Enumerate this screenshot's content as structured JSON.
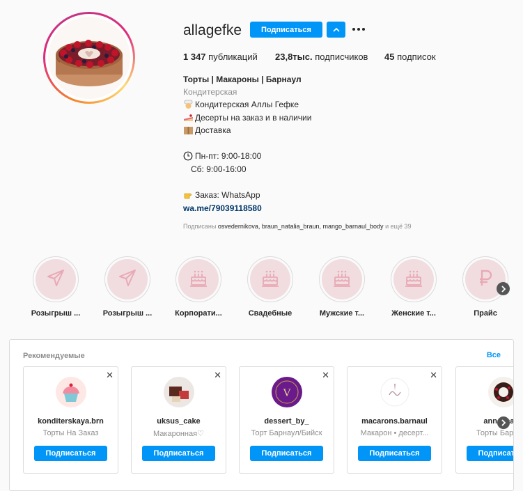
{
  "profile": {
    "username": "allagefke",
    "follow_label": "Подписаться",
    "stats": {
      "posts_num": "1 347",
      "posts_label": " публикаций",
      "followers_num": "23,8тыс.",
      "followers_label": " подписчиков",
      "following_num": "45",
      "following_label": " подписок"
    },
    "bio": {
      "title": "Торты | Макароны | Барнаул",
      "category": "Кондитерская",
      "line1": "Кондитерская Аллы Гефке",
      "line2": "Десерты на заказ и в наличии",
      "line3": "Доставка",
      "hours1": "Пн-пт: 9:00-18:00",
      "hours2": "Сб: 9:00-16:00",
      "order": "Заказ: WhatsApp",
      "link": "wa.me/79039118580"
    },
    "followed_by": {
      "prefix": "Подписаны ",
      "names": "osvedernikova, braun_natalia_braun, mango_barnaul_body",
      "suffix": " и ещё 39"
    }
  },
  "highlights": [
    {
      "label": "Розыгрыш ...",
      "icon": "paper-plane-icon"
    },
    {
      "label": "Розыгрыш ...",
      "icon": "paper-plane-icon"
    },
    {
      "label": "Корпорати...",
      "icon": "cake-icon"
    },
    {
      "label": "Свадебные",
      "icon": "cake-icon"
    },
    {
      "label": "Мужские т...",
      "icon": "cake-icon"
    },
    {
      "label": "Женские т...",
      "icon": "cake-icon"
    },
    {
      "label": "Прайс",
      "icon": "ruble-icon"
    }
  ],
  "recommended": {
    "title": "Рекомендуемые",
    "all_label": "Все",
    "cards": [
      {
        "username": "konditerskaya.brn",
        "subtitle": "Торты На Заказ",
        "button": "Подписаться"
      },
      {
        "username": "uksus_cake",
        "subtitle": "Макаронная♡",
        "button": "Подписаться"
      },
      {
        "username": "dessert_by_",
        "subtitle": "Торт Барнаул/Бийск",
        "button": "Подписаться"
      },
      {
        "username": "macarons.barnaul",
        "subtitle": "Макарон • десерт...",
        "button": "Подписаться"
      },
      {
        "username": "anna_cake",
        "subtitle": "Торты Барнаул",
        "button": "Подписаться"
      }
    ]
  },
  "colors": {
    "accent": "#0095f6",
    "highlight_bg": "#f1dde0",
    "highlight_icon": "#e8a9b5"
  }
}
